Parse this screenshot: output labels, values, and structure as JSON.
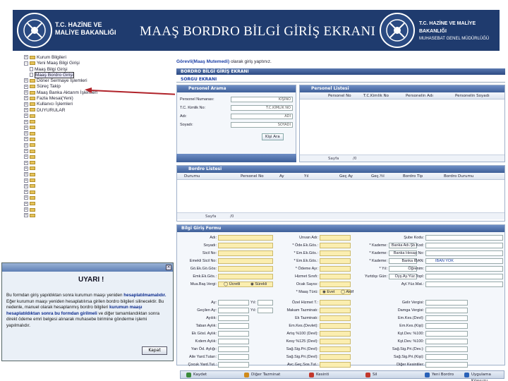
{
  "banner": {
    "left_org_line1": "T.C. HAZİNE VE",
    "left_org_line2": "MALİYE BAKANLIĞI",
    "title": "MAAŞ BORDRO BİLGİ GİRİŞ EKRANI",
    "right_org_line1": "T.C. HAZİNE VE MALİYE BAKANLIĞI",
    "right_org_line2": "MUHASEBAT GENEL MÜDÜRLÜĞÜ"
  },
  "tree": [
    {
      "label": "Kurum Bilgileri",
      "type": "folder",
      "level": 1,
      "pm": "+"
    },
    {
      "label": "Yeni Maaş Bilgi Girişi",
      "type": "folder",
      "level": 1,
      "pm": "-"
    },
    {
      "label": "Maaş Bilgi Girişi",
      "type": "doc",
      "level": 2
    },
    {
      "label": "Maaş Bordro Girişi",
      "type": "doc",
      "level": 2,
      "selected": true
    },
    {
      "label": "Döner Sermaye İşlemleri",
      "type": "folder",
      "level": 1,
      "pm": "+"
    },
    {
      "label": "Süreç Takip",
      "type": "folder",
      "level": 1,
      "pm": "+"
    },
    {
      "label": "Maaş Banka Aktarım İşlemleri",
      "type": "folder",
      "level": 1,
      "pm": "+"
    },
    {
      "label": "Fazla Mesai(Yeni)",
      "type": "folder",
      "level": 1,
      "pm": "+"
    },
    {
      "label": "Kullanıcı İşlemleri",
      "type": "folder",
      "level": 1,
      "pm": "+"
    },
    {
      "label": "DUYURULAR",
      "type": "folder",
      "level": 1,
      "pm": "+"
    }
  ],
  "main": {
    "info_prefix": "Görevli(Maaş Mutemedi)",
    "info_suffix": " olarak giriş yaptınız.",
    "screen_bar": "BORDRO BİLGİ GİRİŞ EKRANI",
    "search_bar": "SORGU EKRANI",
    "personel_arama": "Personel Arama",
    "personel_listesi": "Personel Listesi",
    "search_fields": [
      {
        "label": "Personel Numarası:",
        "value": "KİŞİNO"
      },
      {
        "label": "T.C. Kimlik No:",
        "value": "T.C.KİMLİK NO"
      },
      {
        "label": "Adı:",
        "value": "ADI"
      },
      {
        "label": "Soyadı:",
        "value": "SOYADI"
      }
    ],
    "ara_button": "Kişi Ara",
    "personel_cols": [
      "Personel No",
      "T.C.Kimlik No",
      "Personelin Adı",
      "Personelin Soyadı"
    ],
    "bordro_listesi": "Bordro Listesi",
    "bordro_cols": [
      "Durumu",
      "Personel No",
      "Ay",
      "Yıl",
      "Geç Ay",
      "Geç.Yıl",
      "Bordro Tip",
      "Bordro Durumu"
    ],
    "pager_page": "Sayfa",
    "pager_of": "/0",
    "form_bar": "Bilgi Giriş Formu",
    "form_left": [
      "Adı:",
      "Soyadı:",
      "Sicil No:",
      "Emekli Sicil No:",
      "Gö.Ek.Gö.Gös:",
      "Emk.Ek.Gös.:",
      "Mua.Baş.Vergi:"
    ],
    "form_mid": [
      "Unvan Adı:",
      "* Öde.Ek.Gös.:",
      "* Em.Ek.Gös.:",
      "* Em.Ek.Gös.:",
      "* Ödeme Ayı:",
      "Hizmet Sınıfı:",
      "Ocak Sayısı:",
      "* Maaş Türü:"
    ],
    "form_mid2": [
      "* Kademe:",
      "* Kademe:",
      "* Kademe:",
      "* Yıl:",
      "Yurtdışı Gün:"
    ],
    "form_right": [
      "Şube Kodu:",
      "Banka Adı.Şb.Kod:",
      "Banka Hesap No:",
      "Banka IBAN:",
      "Öğrenim:",
      "Oyş.Ay.Yüz.Topl:",
      "Ayl.Yüz.Mat.:"
    ],
    "iban_value": "IBAN YOK",
    "mua_options": [
      "Ücretli",
      "Sürekli"
    ],
    "maas_turu_options": [
      "Evet",
      "Aktif"
    ],
    "form2_left": [
      "Ay:",
      "Geçilen Ay:",
      "Ayılık:",
      "Taban Aylık:",
      "Ek Gösl. Aylık:",
      "Kıdem Aylık:",
      "Yan Öd. Aylığı:",
      "Aile Yard.Tutarı:",
      "Çocuk Yard.Tut.:"
    ],
    "form2_yil": [
      "Yıl:",
      "Yıl:"
    ],
    "form2_mid": [
      "Özel Hizmet T.:",
      "Makam Tazminatı:",
      "Ek Tazminatı:",
      "Em.Kes.(Devlet):",
      "Artış %100 (Devl):",
      "Kesy %125 (Devl):",
      "Sağ.Sig.Pri.(Devl):",
      "Sağ.Sig.Pri.(Devl):",
      "Avc.Geç.Sos.Tut.:"
    ],
    "form2_right": [
      "Gelir Vergisi:",
      "Damga Vergisi:",
      "Em.Kes.(Devl):",
      "Em.Kes.(Kişi):",
      "Kşt.Dev. %100:",
      "Kşt.Dev. %100:",
      "Sağ.Sig.Pri.(Dev.):",
      "Sağ.Sig.Pri.(Kişi):",
      "Diğer Kesintiler:"
    ]
  },
  "dialog": {
    "title": "UYARI !",
    "p1_a": "Bu formdan giriş yapıldıktan sonra kurumun maaşı yeniden ",
    "p1_b": "hesaplatılmamalıdır.",
    "p2": " Eğer kurumun maaşı yeniden hesaplatılırsa girilen bordro bilgileri silinecektir.",
    "p3_a": " Bu nedenle, manuel olarak hesaplanmış bordro bilgileri ",
    "p3_b": "kurumun maaşı hesaplatıldıktan sonra bu formdan girilmeli",
    "p3_c": " ve diğer tamamlandıktan sonra direkt ödeme emri belgesi alınarak muhasebe birimine gönderme işlemi yapılmalıdır.",
    "ok": "Kapat"
  },
  "toolbar": [
    {
      "label": "Kaydet",
      "color": "#3a8a3a"
    },
    {
      "label": "Diğer Tazminat",
      "color": "#d08a1a"
    },
    {
      "label": "Kesinti",
      "color": "#c2372c"
    },
    {
      "label": "Sil",
      "color": "#c2372c"
    },
    {
      "label": "Yeni Bordro",
      "color": "#2a62b8"
    },
    {
      "label": "Uygulama Kılavuzu",
      "color": "#2a62b8"
    }
  ]
}
